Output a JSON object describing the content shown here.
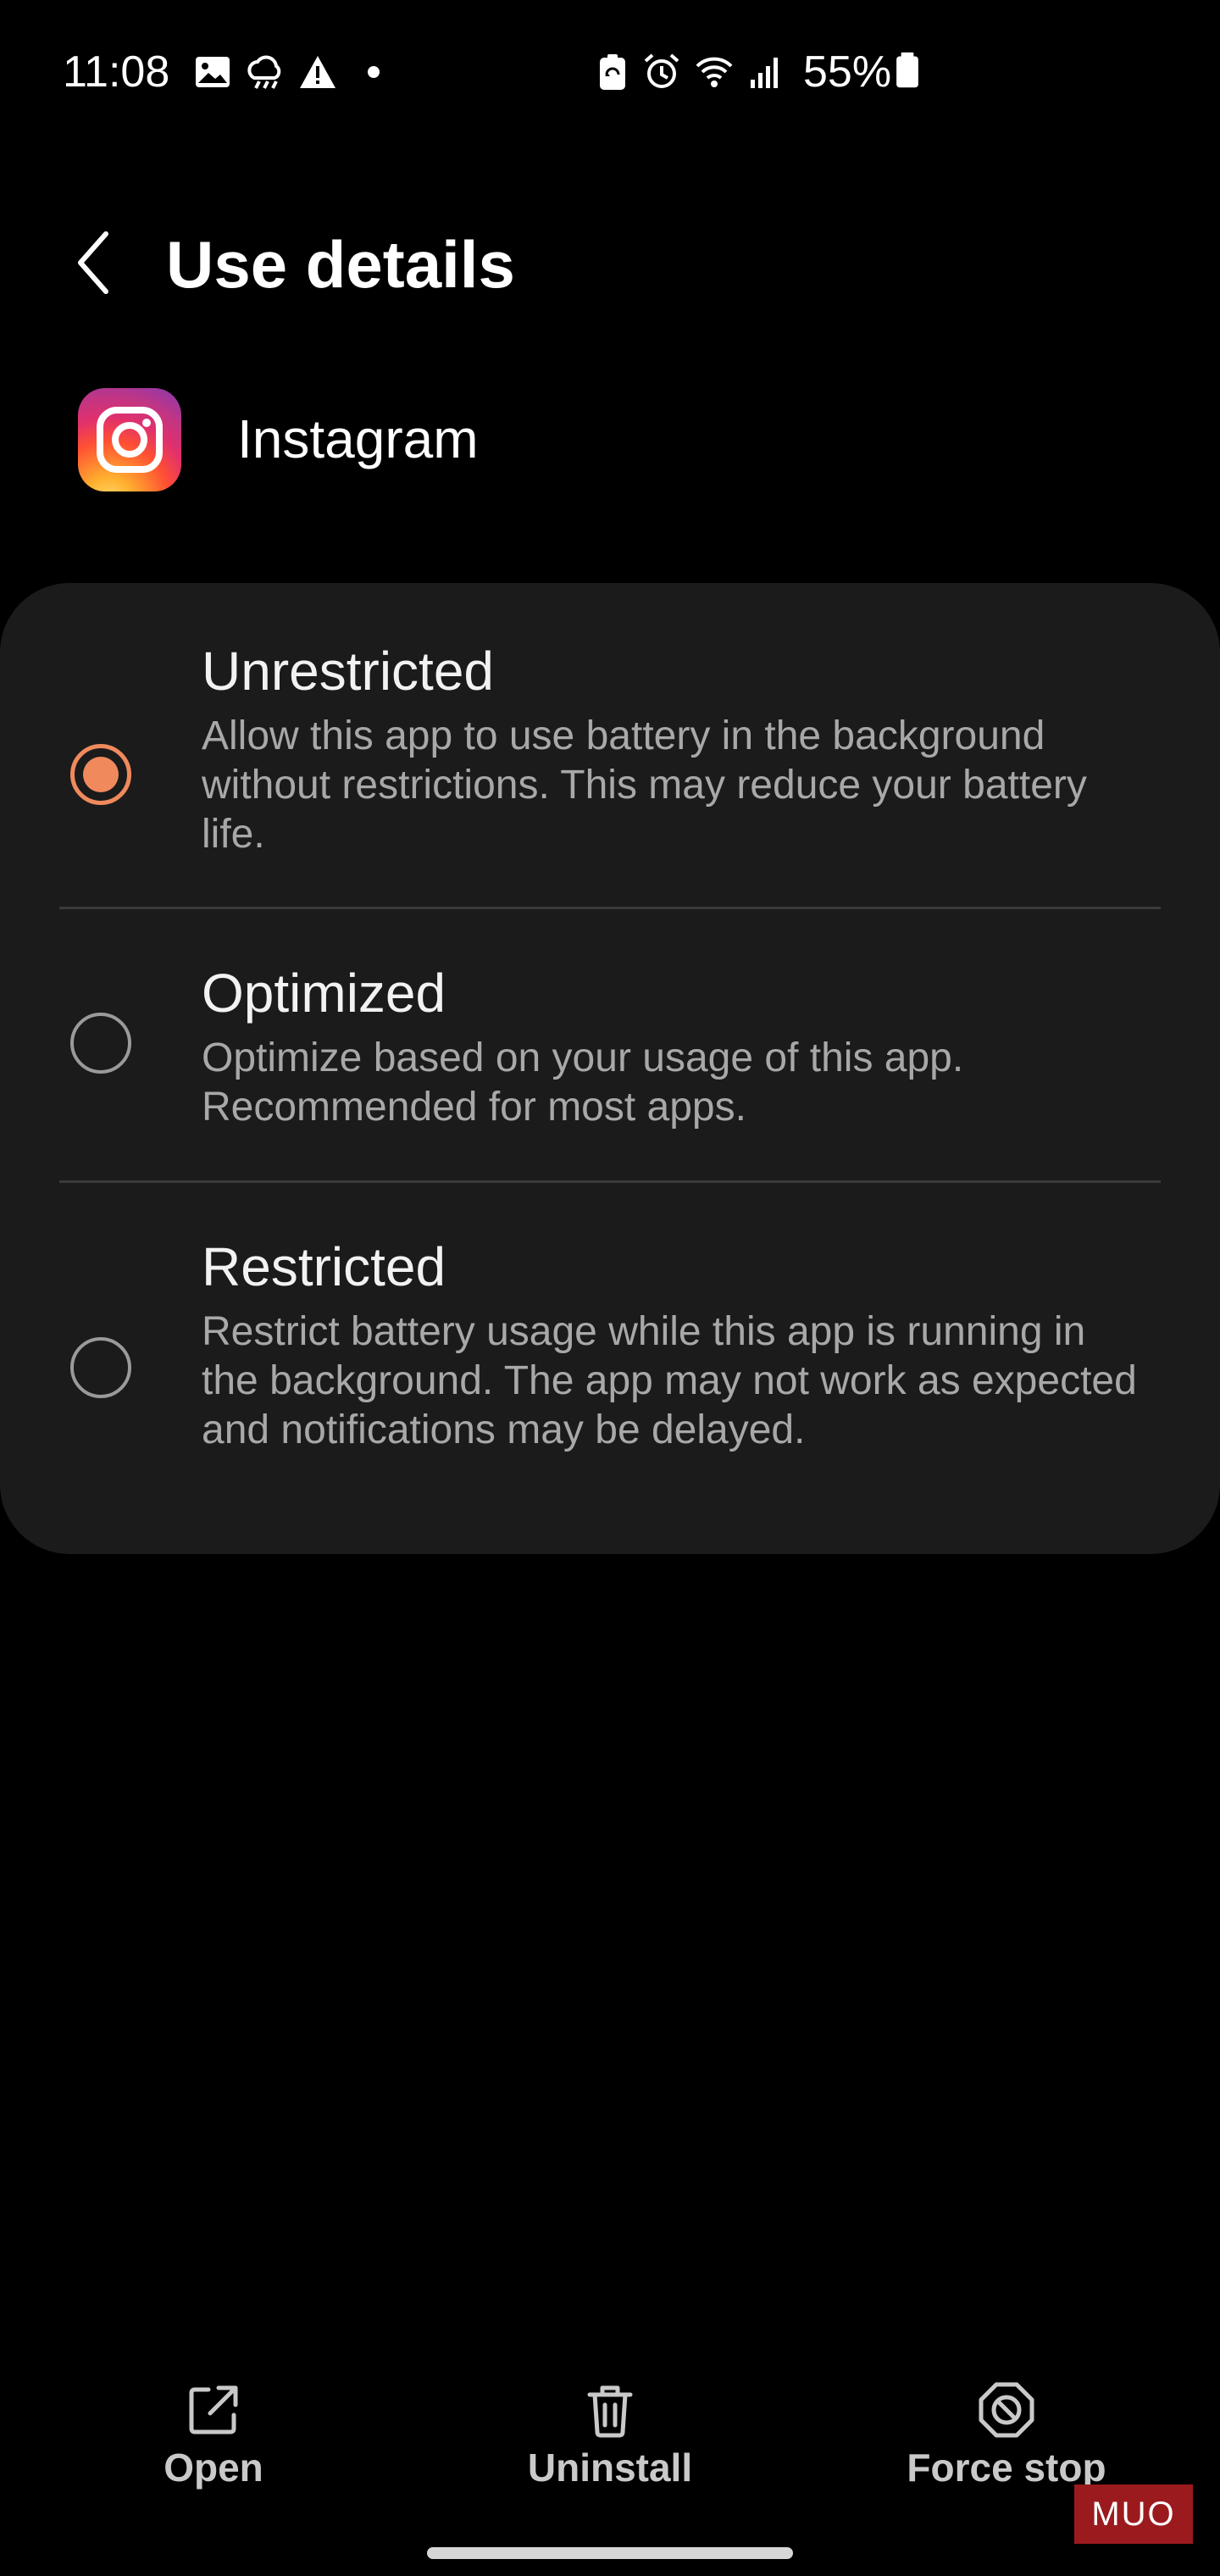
{
  "status_bar": {
    "time": "11:08",
    "battery_text": "55%",
    "icons": [
      "gallery-icon",
      "weather-icon",
      "alert-icon",
      "dot-icon",
      "battery-saver-icon",
      "alarm-icon",
      "wifi-icon",
      "signal-icon",
      "battery-icon"
    ]
  },
  "header": {
    "title": "Use details",
    "back_icon": "chevron-left-icon"
  },
  "app": {
    "name": "Instagram",
    "icon": "instagram-icon"
  },
  "options": [
    {
      "title": "Unrestricted",
      "description": "Allow this app to use battery in the background without restrictions. This may reduce your battery life.",
      "selected": true
    },
    {
      "title": "Optimized",
      "description": "Optimize based on your usage of this app. Recommended for most apps.",
      "selected": false
    },
    {
      "title": "Restricted",
      "description": "Restrict battery usage while this app is running in the background. The app may not work as expected and notifications may be delayed.",
      "selected": false
    }
  ],
  "bottom_actions": [
    {
      "label": "Open",
      "icon": "open-external-icon"
    },
    {
      "label": "Uninstall",
      "icon": "trash-icon"
    },
    {
      "label": "Force stop",
      "icon": "block-icon"
    }
  ],
  "watermark": "MUO",
  "colors": {
    "accent": "#f08a5d",
    "background": "#000000",
    "card": "#1b1b1b",
    "secondary_text": "#a8a8a8"
  }
}
